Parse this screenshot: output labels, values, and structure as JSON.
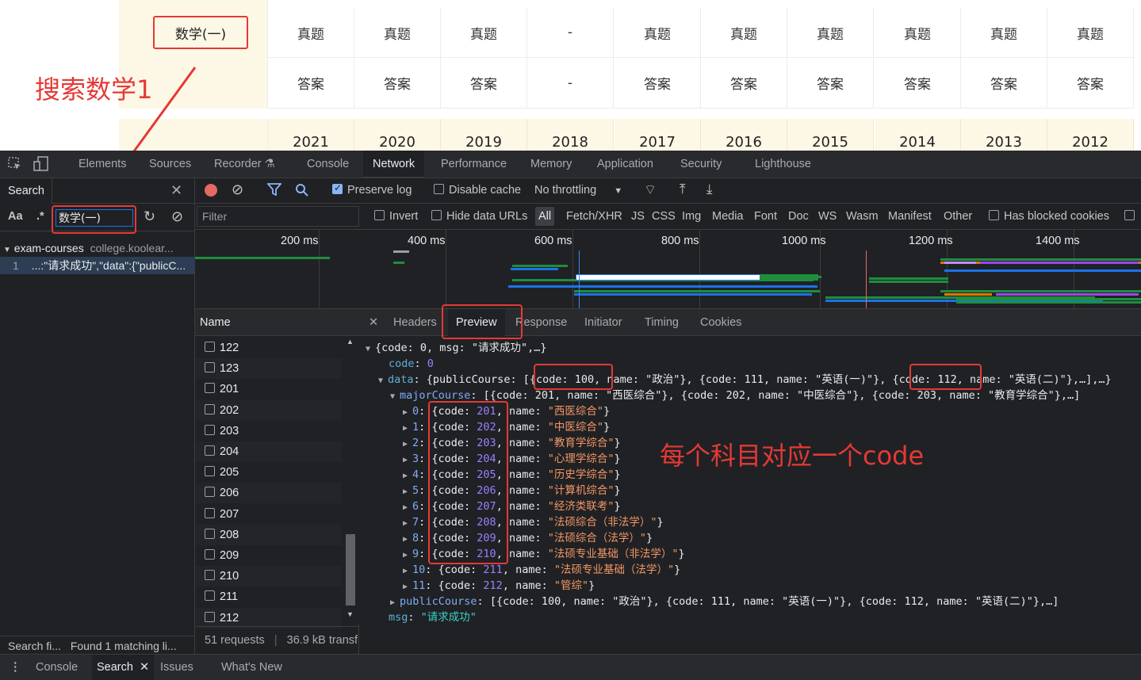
{
  "webpage": {
    "subject_label": "数学(一)",
    "row_zhenti": [
      "真题",
      "真题",
      "真题",
      "-",
      "真题",
      "真题",
      "真题",
      "真题",
      "真题",
      "真题"
    ],
    "row_answer": [
      "答案",
      "答案",
      "答案",
      "-",
      "答案",
      "答案",
      "答案",
      "答案",
      "答案",
      "答案"
    ],
    "years": [
      "2021",
      "2020",
      "2019",
      "2018",
      "2017",
      "2016",
      "2015",
      "2014",
      "2013",
      "2012"
    ]
  },
  "annotations": {
    "search_note": "搜索数学1",
    "code_note": "每个科目对应一个code"
  },
  "devtools": {
    "main_tabs": [
      "Elements",
      "Sources",
      "Recorder",
      "Console",
      "Network",
      "Performance",
      "Memory",
      "Application",
      "Security",
      "Lighthouse"
    ],
    "active_main_tab": "Network",
    "search": {
      "title": "Search",
      "case_toggle": "Aa",
      "regex_toggle": ".*",
      "query": "数学(一)",
      "result_file": "exam-courses",
      "result_domain": "college.koolear...",
      "result_line_no": "1",
      "result_line_text": "...:\"请求成功\",\"data\":{\"publicC...",
      "status_left": "Search fi...",
      "status_right": "Found 1 matching li..."
    },
    "toolbar": {
      "preserve_log": "Preserve log",
      "disable_cache": "Disable cache",
      "throttling": "No throttling"
    },
    "filter": {
      "placeholder": "Filter",
      "invert": "Invert",
      "hide_data_urls": "Hide data URLs",
      "types": [
        "All",
        "Fetch/XHR",
        "JS",
        "CSS",
        "Img",
        "Media",
        "Font",
        "Doc",
        "WS",
        "Wasm",
        "Manifest",
        "Other"
      ],
      "has_blocked_cookies": "Has blocked cookies"
    },
    "overview_labels": [
      "200 ms",
      "400 ms",
      "600 ms",
      "800 ms",
      "1000 ms",
      "1200 ms",
      "1400 ms"
    ],
    "name_column": {
      "header": "Name",
      "rows": [
        "122",
        "123",
        "201",
        "202",
        "203",
        "204",
        "205",
        "206",
        "207",
        "208",
        "209",
        "210",
        "211",
        "212"
      ],
      "status_requests": "51 requests",
      "status_transfer": "36.9 kB transf"
    },
    "preview_tabs": [
      "Headers",
      "Preview",
      "Response",
      "Initiator",
      "Timing",
      "Cookies"
    ],
    "active_preview_tab": "Preview",
    "json": {
      "root_summary": "{code: 0, msg: \"请求成功\",…}",
      "code_key": "code",
      "code_val": "0",
      "data_key": "data",
      "data_summary_a": "{publicCourse: [",
      "data_summary_b": "{code: 100, name: \"政治\"}, {code: 111, name: \"英语(一)\"}, {code: 112, name: \"英语(二)\"},…],…}",
      "major_key": "majorCourse",
      "major_summary": "[{code: 201, name: \"西医综合\"}, {code: 202, name: \"中医综合\"}, {code: 203, name: \"教育学综合\"},…]",
      "major_items": [
        {
          "i": "0",
          "code": "201",
          "name": "\"西医综合\""
        },
        {
          "i": "1",
          "code": "202",
          "name": "\"中医综合\""
        },
        {
          "i": "2",
          "code": "203",
          "name": "\"教育学综合\""
        },
        {
          "i": "3",
          "code": "204",
          "name": "\"心理学综合\""
        },
        {
          "i": "4",
          "code": "205",
          "name": "\"历史学综合\""
        },
        {
          "i": "5",
          "code": "206",
          "name": "\"计算机综合\""
        },
        {
          "i": "6",
          "code": "207",
          "name": "\"经济类联考\""
        },
        {
          "i": "7",
          "code": "208",
          "name": "\"法硕综合（非法学）\""
        },
        {
          "i": "8",
          "code": "209",
          "name": "\"法硕综合（法学）\""
        },
        {
          "i": "9",
          "code": "210",
          "name": "\"法硕专业基础（非法学）\""
        },
        {
          "i": "10",
          "code": "211",
          "name": "\"法硕专业基础（法学）\""
        },
        {
          "i": "11",
          "code": "212",
          "name": "\"管综\""
        }
      ],
      "public_key": "publicCourse",
      "public_summary": "[{code: 100, name: \"政治\"}, {code: 111, name: \"英语(一)\"}, {code: 112, name: \"英语(二)\"},…]",
      "msg_key": "msg",
      "msg_val": "\"请求成功\""
    },
    "drawer_tabs": [
      "Console",
      "Search",
      "Issues",
      "What's New"
    ],
    "active_drawer_tab": "Search"
  },
  "colors": {
    "annotation_red": "#e53935",
    "devtools_bg": "#202124",
    "accent_blue": "#8ab4f8",
    "record_red": "#e46962"
  }
}
